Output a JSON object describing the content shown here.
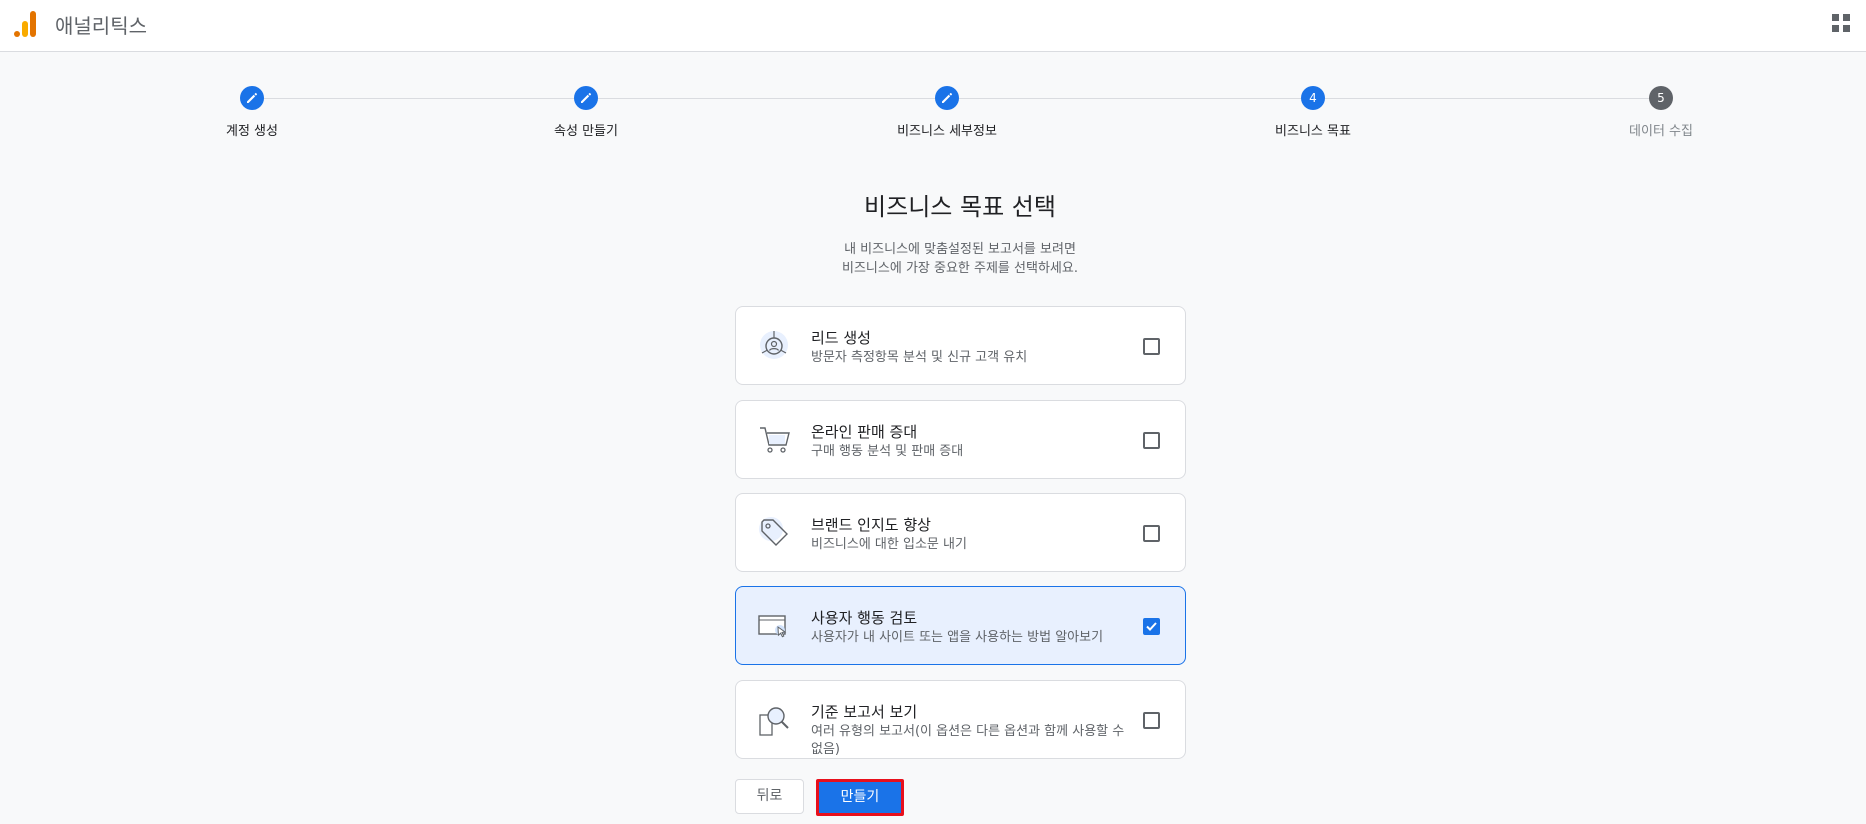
{
  "header": {
    "app_name": "애널리틱스"
  },
  "stepper": {
    "steps": [
      {
        "number": "",
        "label": "계정 생성",
        "state": "completed"
      },
      {
        "number": "",
        "label": "속성 만들기",
        "state": "completed"
      },
      {
        "number": "",
        "label": "비즈니스 세부정보",
        "state": "completed"
      },
      {
        "number": "4",
        "label": "비즈니스 목표",
        "state": "current"
      },
      {
        "number": "5",
        "label": "데이터 수집",
        "state": "upcoming"
      }
    ]
  },
  "main": {
    "title": "비즈니스 목표 선택",
    "subtitle_line1": "내 비즈니스에 맞춤설정된 보고서를 보려면",
    "subtitle_line2": "비즈니스에 가장 중요한 주제를 선택하세요.",
    "options": [
      {
        "title": "리드 생성",
        "description": "방문자 측정항목 분석 및 신규 고객 유치",
        "icon": "lead-generation-icon",
        "checked": false
      },
      {
        "title": "온라인 판매 증대",
        "description": "구매 행동 분석 및 판매 증대",
        "icon": "shopping-cart-icon",
        "checked": false
      },
      {
        "title": "브랜드 인지도 향상",
        "description": "비즈니스에 대한 입소문 내기",
        "icon": "tag-icon",
        "checked": false
      },
      {
        "title": "사용자 행동 검토",
        "description": "사용자가 내 사이트 또는 앱을 사용하는 방법 알아보기",
        "icon": "cursor-window-icon",
        "checked": true
      },
      {
        "title": "기준 보고서 보기",
        "description": "여러 유형의 보고서(이 옵션은 다른 옵션과 함께 사용할 수 없음)",
        "icon": "magnifier-report-icon",
        "checked": false
      }
    ]
  },
  "footer": {
    "back_label": "뒤로",
    "create_label": "만들기"
  },
  "colors": {
    "accent": "#1a73e8",
    "highlight_border": "#e8101c",
    "brand_orange": "#e37400"
  }
}
